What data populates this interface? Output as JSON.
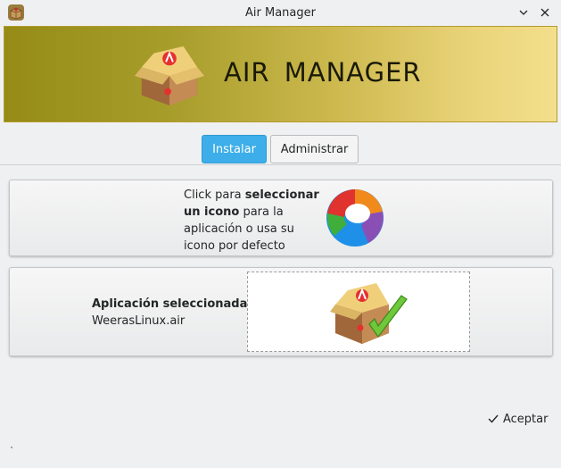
{
  "window": {
    "title": "Air Manager"
  },
  "banner": {
    "title": "AIR  MANAGER"
  },
  "tabs": [
    {
      "label": "Instalar",
      "active": true
    },
    {
      "label": "Administrar",
      "active": false
    }
  ],
  "icon_panel": {
    "text_pre": "Click para ",
    "text_bold": "seleccionar un icono",
    "text_post": " para la aplicación o usa su icono por defecto"
  },
  "app_panel": {
    "label": "Aplicación seleccionada:",
    "value": "WeerasLinux.air"
  },
  "footer": {
    "accept_label": "Aceptar"
  },
  "colors": {
    "accent": "#3daee9",
    "banner_start": "#958b16",
    "banner_end": "#f3df8c"
  },
  "icons": {
    "app": "adobe-air-box-icon",
    "minimize": "chevron-down-icon",
    "close": "close-icon",
    "default_app": "color-wheel-icon",
    "selected": "box-checkmark-icon",
    "accept": "checkmark-icon"
  }
}
